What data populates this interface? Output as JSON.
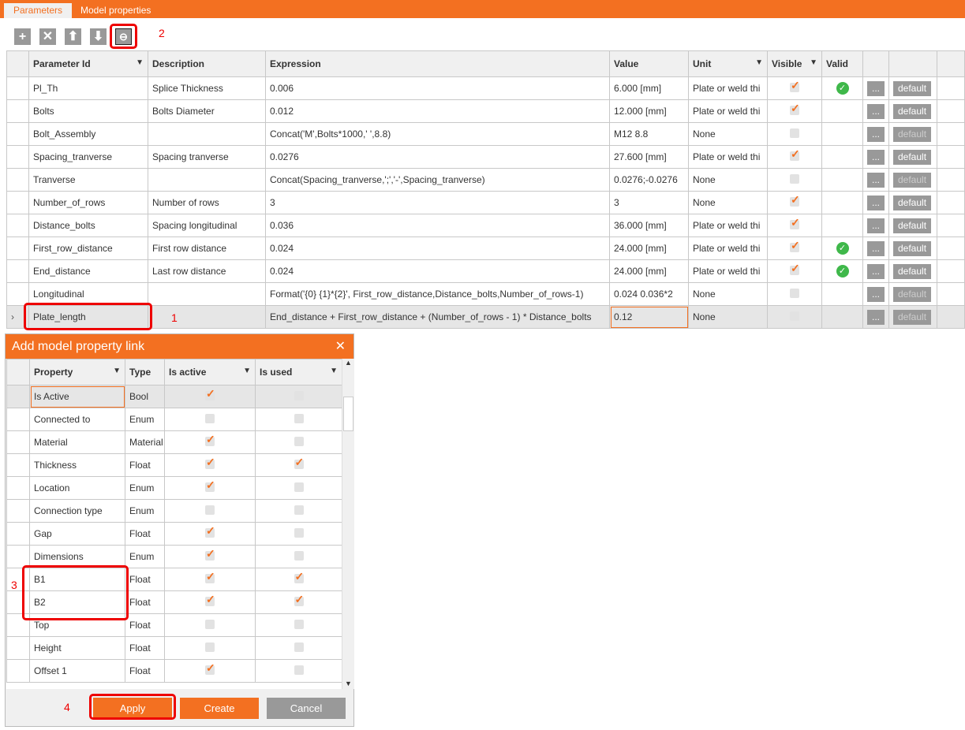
{
  "tabs": [
    {
      "label": "Parameters",
      "active": true
    },
    {
      "label": "Model properties",
      "active": false
    }
  ],
  "toolbar": {
    "icons": [
      "plus-icon",
      "delete-icon",
      "move-up-icon",
      "move-down-icon",
      "link-icon"
    ]
  },
  "annotations": {
    "n1": "1",
    "n2": "2",
    "n3": "3",
    "n4": "4"
  },
  "colors": {
    "accent": "#f37021",
    "highlight": "#e00000",
    "button_gray": "#999999",
    "valid": "#3fb84a"
  },
  "grid": {
    "headers": [
      "Parameter Id",
      "Description",
      "Expression",
      "Value",
      "Unit",
      "Visible",
      "Valid",
      "",
      ""
    ],
    "more_label": "...",
    "default_label": "default",
    "rows": [
      {
        "id": "Pl_Th",
        "desc": "Splice Thickness",
        "expr": "0.006",
        "value": "6.000 [mm]",
        "unit": "Plate or weld thi",
        "visible": true,
        "valid": true,
        "def_enabled": true
      },
      {
        "id": "Bolts",
        "desc": "Bolts Diameter",
        "expr": "0.012",
        "value": "12.000 [mm]",
        "unit": "Plate or weld thi",
        "visible": true,
        "valid": false,
        "def_enabled": true
      },
      {
        "id": "Bolt_Assembly",
        "desc": "",
        "expr": "Concat('M',Bolts*1000,' ',8.8)",
        "value": "M12 8.8",
        "unit": "None",
        "visible": false,
        "valid": false,
        "def_enabled": false
      },
      {
        "id": "Spacing_tranverse",
        "desc": "Spacing tranverse",
        "expr": "0.0276",
        "value": "27.600 [mm]",
        "unit": "Plate or weld thi",
        "visible": true,
        "valid": false,
        "def_enabled": true
      },
      {
        "id": "Tranverse",
        "desc": "",
        "expr": "Concat(Spacing_tranverse,';','-',Spacing_tranverse)",
        "value": "0.0276;-0.0276",
        "unit": "None",
        "visible": false,
        "valid": false,
        "def_enabled": false
      },
      {
        "id": "Number_of_rows",
        "desc": "Number of rows",
        "expr": "3",
        "value": "3",
        "unit": "None",
        "visible": true,
        "valid": false,
        "def_enabled": true
      },
      {
        "id": "Distance_bolts",
        "desc": "Spacing longitudinal",
        "expr": "0.036",
        "value": "36.000 [mm]",
        "unit": "Plate or weld thi",
        "visible": true,
        "valid": false,
        "def_enabled": true
      },
      {
        "id": "First_row_distance",
        "desc": "First row distance",
        "expr": "0.024",
        "value": "24.000 [mm]",
        "unit": "Plate or weld thi",
        "visible": true,
        "valid": true,
        "def_enabled": true
      },
      {
        "id": "End_distance",
        "desc": "Last row distance",
        "expr": "0.024",
        "value": "24.000 [mm]",
        "unit": "Plate or weld thi",
        "visible": true,
        "valid": true,
        "def_enabled": true
      },
      {
        "id": "Longitudinal",
        "desc": "",
        "expr": "Format('{0} {1}*{2}', First_row_distance,Distance_bolts,Number_of_rows-1)",
        "value": "0.024 0.036*2",
        "unit": "None",
        "visible": false,
        "valid": false,
        "def_enabled": false
      },
      {
        "id": "Plate_length",
        "desc": "",
        "expr": "End_distance + First_row_distance + (Number_of_rows - 1) * Distance_bolts",
        "value": "0.12",
        "unit": "None",
        "visible": false,
        "valid": false,
        "def_enabled": false,
        "selected": true
      }
    ]
  },
  "dialog": {
    "title": "Add model property link",
    "headers": [
      "Property",
      "Type",
      "Is active",
      "Is used"
    ],
    "rows": [
      {
        "property": "Is Active",
        "type": "Bool",
        "active": true,
        "used": false,
        "selected": true
      },
      {
        "property": "Connected to",
        "type": "Enum",
        "active": false,
        "used": false
      },
      {
        "property": "Material",
        "type": "Material",
        "active": true,
        "used": false
      },
      {
        "property": "Thickness",
        "type": "Float",
        "active": true,
        "used": true
      },
      {
        "property": "Location",
        "type": "Enum",
        "active": true,
        "used": false
      },
      {
        "property": "Connection type",
        "type": "Enum",
        "active": false,
        "used": false
      },
      {
        "property": "Gap",
        "type": "Float",
        "active": true,
        "used": false
      },
      {
        "property": "Dimensions",
        "type": "Enum",
        "active": true,
        "used": false
      },
      {
        "property": "B1",
        "type": "Float",
        "active": true,
        "used": true
      },
      {
        "property": "B2",
        "type": "Float",
        "active": true,
        "used": true
      },
      {
        "property": "Top",
        "type": "Float",
        "active": false,
        "used": false
      },
      {
        "property": "Height",
        "type": "Float",
        "active": false,
        "used": false
      },
      {
        "property": "Offset 1",
        "type": "Float",
        "active": true,
        "used": false
      }
    ],
    "apply": "Apply",
    "create": "Create",
    "cancel": "Cancel"
  }
}
